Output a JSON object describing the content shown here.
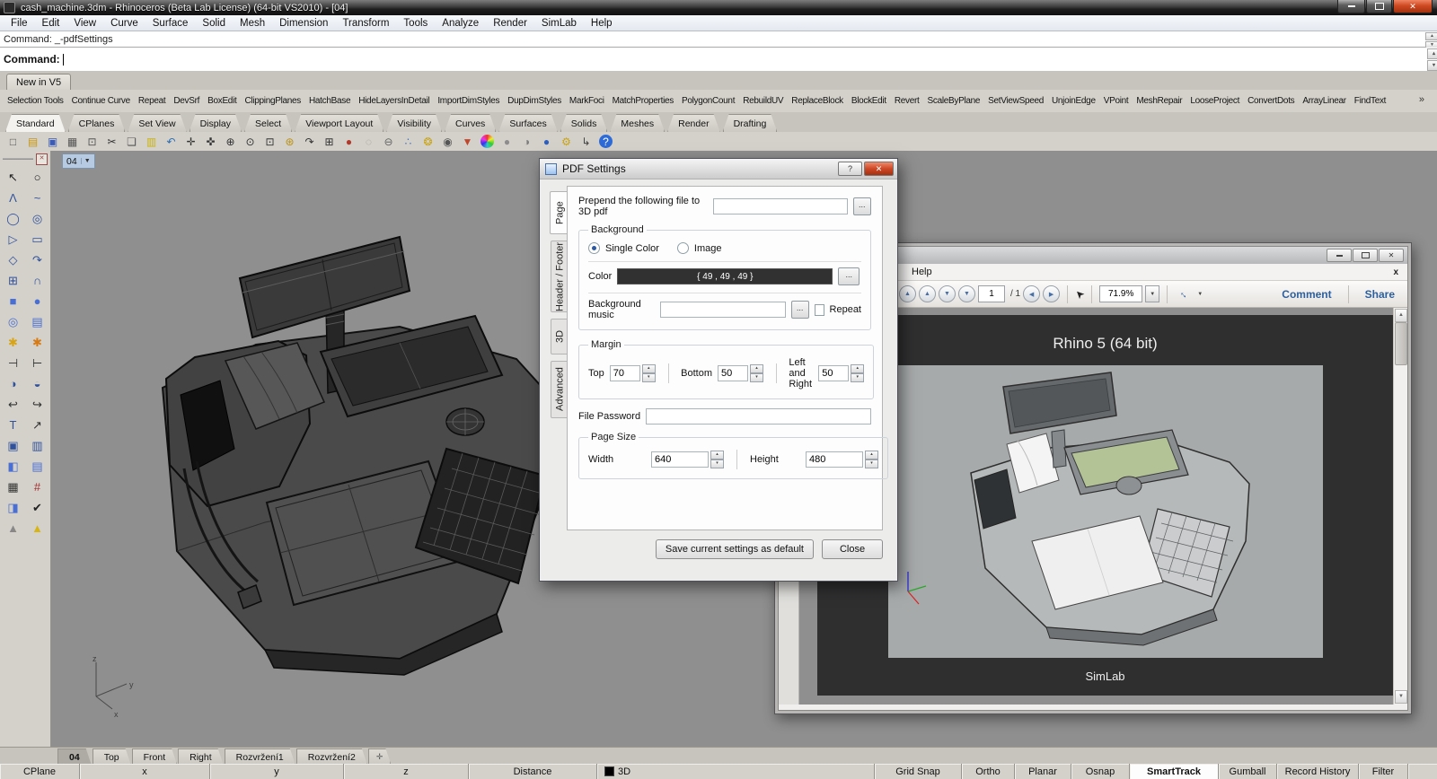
{
  "glyphs": {
    "close": "✕",
    "help": "?",
    "spin_up": "▴",
    "spin_down": "▾",
    "scroll_up": "▲",
    "scroll_down": "▼",
    "dd": "▼",
    "overflow": "»",
    "select_tool": "➤",
    "fullscreen": "↔",
    "plus_tab": "✛"
  },
  "app": {
    "title": "cash_machine.3dm - Rhinoceros (Beta Lab License) (64-bit VS2010) - [04]",
    "menus": [
      "File",
      "Edit",
      "View",
      "Curve",
      "Surface",
      "Solid",
      "Mesh",
      "Dimension",
      "Transform",
      "Tools",
      "Analyze",
      "Render",
      "SimLab",
      "Help"
    ]
  },
  "command": {
    "history": "Command: _-pdfSettings",
    "prompt": "Command:"
  },
  "dock": {
    "group_tab": "New in V5",
    "links": [
      "Selection Tools",
      "Continue Curve",
      "Repeat",
      "DevSrf",
      "BoxEdit",
      "ClippingPlanes",
      "HatchBase",
      "HideLayersInDetail",
      "ImportDimStyles",
      "DupDimStyles",
      "MarkFoci",
      "MatchProperties",
      "PolygonCount",
      "RebuildUV",
      "ReplaceBlock",
      "BlockEdit",
      "Revert",
      "ScaleByPlane",
      "SetViewSpeed",
      "UnjoinEdge",
      "VPoint",
      "MeshRepair",
      "LooseProject",
      "ConvertDots",
      "ArrayLinear",
      "FindText"
    ]
  },
  "toolbar_tabs": [
    {
      "label": "Standard",
      "active": true
    },
    {
      "label": "CPlanes"
    },
    {
      "label": "Set View"
    },
    {
      "label": "Display"
    },
    {
      "label": "Select"
    },
    {
      "label": "Viewport Layout"
    },
    {
      "label": "Visibility"
    },
    {
      "label": "Curves"
    },
    {
      "label": "Surfaces"
    },
    {
      "label": "Solids"
    },
    {
      "label": "Meshes"
    },
    {
      "label": "Render"
    },
    {
      "label": "Drafting"
    }
  ],
  "std_icons": [
    {
      "name": "new-file-icon",
      "g": "□",
      "c": "#555"
    },
    {
      "name": "open-icon",
      "g": "▤",
      "c": "#c99714"
    },
    {
      "name": "save-icon",
      "g": "▣",
      "c": "#3b5bb5"
    },
    {
      "name": "print-icon",
      "g": "▦",
      "c": "#555"
    },
    {
      "name": "export-icon",
      "g": "⊡",
      "c": "#555"
    },
    {
      "name": "cut-icon",
      "g": "✂",
      "c": "#333"
    },
    {
      "name": "copy-icon",
      "g": "❏",
      "c": "#555"
    },
    {
      "name": "paste-icon",
      "g": "▥",
      "c": "#c9b414"
    },
    {
      "name": "undo-icon",
      "g": "↶",
      "c": "#2f6fb3"
    },
    {
      "name": "pan-icon",
      "g": "✛",
      "c": "#333"
    },
    {
      "name": "orbit-icon",
      "g": "✜",
      "c": "#333"
    },
    {
      "name": "zoom-in-icon",
      "g": "⊕",
      "c": "#333"
    },
    {
      "name": "zoom-dynamic-icon",
      "g": "⊙",
      "c": "#333"
    },
    {
      "name": "zoom-window-icon",
      "g": "⊡",
      "c": "#333"
    },
    {
      "name": "zoom-extents-icon",
      "g": "⊛",
      "c": "#b99114"
    },
    {
      "name": "rotate-view-icon",
      "g": "↷",
      "c": "#333"
    },
    {
      "name": "viewport-layout-icon",
      "g": "⊞",
      "c": "#333"
    },
    {
      "name": "car-icon",
      "g": "●",
      "c": "#b33a2a"
    },
    {
      "name": "ghost-icon",
      "g": "◌",
      "c": "#999"
    },
    {
      "name": "section-icon",
      "g": "⊖",
      "c": "#666"
    },
    {
      "name": "nodes-icon",
      "g": "∴",
      "c": "#4a72c4"
    },
    {
      "name": "lamp-icon",
      "g": "❂",
      "c": "#c9a414"
    },
    {
      "name": "lock-icon",
      "g": "◉",
      "c": "#555"
    },
    {
      "name": "shaded-display-icon",
      "g": "▼",
      "c": "#c1472b"
    },
    {
      "name": "color-wheel-icon",
      "g": "",
      "c": "#333",
      "bg": "conic-gradient(#e33,#ee3,#3c3,#3cc,#33e,#e3e,#e33)",
      "round": "50%"
    },
    {
      "name": "sphere-icon",
      "g": "●",
      "c": "#8d8d8d"
    },
    {
      "name": "sphere-shaded-icon",
      "g": "◑",
      "c": "#7c7c7c"
    },
    {
      "name": "sphere-blue-icon",
      "g": "●",
      "c": "#2d5fc0"
    },
    {
      "name": "gear-icon",
      "g": "⚙",
      "c": "#c9a414"
    },
    {
      "name": "layout-lines-icon",
      "g": "↳",
      "c": "#444"
    },
    {
      "name": "help-icon",
      "g": "?",
      "c": "#fff",
      "bg": "#2e6bd6",
      "round": "50%"
    }
  ],
  "sidebar_icons": [
    {
      "name": "select-arrow-icon",
      "g": "↖",
      "c": "#222"
    },
    {
      "name": "point-icon",
      "g": "○",
      "c": "#222"
    },
    {
      "name": "polyline-icon",
      "g": "Λ",
      "c": "#30519c"
    },
    {
      "name": "curve-icon",
      "g": "~",
      "c": "#30519c"
    },
    {
      "name": "circle-icon",
      "g": "◯",
      "c": "#30519c"
    },
    {
      "name": "ellipse-icon",
      "g": "◎",
      "c": "#30519c"
    },
    {
      "name": "arc-icon",
      "g": "▷",
      "c": "#30519c"
    },
    {
      "name": "rectangle-icon",
      "g": "▭",
      "c": "#30519c"
    },
    {
      "name": "polygon-icon",
      "g": "◇",
      "c": "#30519c"
    },
    {
      "name": "freeform-curve-icon",
      "g": "↷",
      "c": "#30519c"
    },
    {
      "name": "surface-icon",
      "g": "⊞",
      "c": "#30519c"
    },
    {
      "name": "patch-icon",
      "g": "∩",
      "c": "#30519c"
    },
    {
      "name": "box-icon",
      "g": "■",
      "c": "#4a6fd4"
    },
    {
      "name": "sphere-solid-icon",
      "g": "●",
      "c": "#4a6fd4"
    },
    {
      "name": "torus-icon",
      "g": "◎",
      "c": "#4a6fd4"
    },
    {
      "name": "planes-icon",
      "g": "▤",
      "c": "#4a6fd4"
    },
    {
      "name": "explode-icon",
      "g": "✱",
      "c": "#d8a414"
    },
    {
      "name": "burst-icon",
      "g": "✱",
      "c": "#d87a14"
    },
    {
      "name": "trim-icon",
      "g": "⊣",
      "c": "#333"
    },
    {
      "name": "split-icon",
      "g": "⊢",
      "c": "#333"
    },
    {
      "name": "boolean-union-icon",
      "g": "◑",
      "c": "#30519c"
    },
    {
      "name": "boolean-diff-icon",
      "g": "◒",
      "c": "#30519c"
    },
    {
      "name": "fillet-icon",
      "g": "↩",
      "c": "#333"
    },
    {
      "name": "blend-icon",
      "g": "↪",
      "c": "#333"
    },
    {
      "name": "text-icon",
      "g": "T",
      "c": "#30519c"
    },
    {
      "name": "dimension-icon",
      "g": "↗",
      "c": "#333"
    },
    {
      "name": "block-icon",
      "g": "▣",
      "c": "#30519c"
    },
    {
      "name": "array-edit-icon",
      "g": "▥",
      "c": "#30519c"
    },
    {
      "name": "solid-tools-icon",
      "g": "◧",
      "c": "#4a6fd4"
    },
    {
      "name": "extrude-icon",
      "g": "▤",
      "c": "#4a6fd4"
    },
    {
      "name": "array-icon",
      "g": "▦",
      "c": "#333"
    },
    {
      "name": "frame-icon",
      "g": "#",
      "c": "#a03030"
    },
    {
      "name": "paint-icon",
      "g": "◨",
      "c": "#4a6fd4"
    },
    {
      "name": "check-icon",
      "g": "✔",
      "c": "#222"
    },
    {
      "name": "cone-icon",
      "g": "▲",
      "c": "#888"
    },
    {
      "name": "pyramid-icon",
      "g": "▲",
      "c": "#d8b414"
    }
  ],
  "viewport": {
    "tab": "04",
    "axis": {
      "x": "x",
      "y": "y",
      "z": "z"
    }
  },
  "viewport_tabs": [
    {
      "label": "04",
      "active": true
    },
    {
      "label": "Top"
    },
    {
      "label": "Front"
    },
    {
      "label": "Right"
    },
    {
      "label": "Rozvržení1"
    },
    {
      "label": "Rozvržení2"
    }
  ],
  "status": {
    "cells": [
      "CPlane",
      "x",
      "y",
      "z",
      "Distance"
    ],
    "layer": "3D",
    "toggles": [
      {
        "label": "Grid Snap"
      },
      {
        "label": "Ortho"
      },
      {
        "label": "Planar"
      },
      {
        "label": "Osnap"
      },
      {
        "label": "SmartTrack",
        "active": true
      },
      {
        "label": "Gumball"
      },
      {
        "label": "Record History"
      },
      {
        "label": "Filter"
      }
    ]
  },
  "dialog": {
    "title": "PDF Settings",
    "tabs": [
      {
        "label": "Page",
        "active": true
      },
      {
        "label": "Header / Footer"
      },
      {
        "label": "3D"
      },
      {
        "label": "Advanced"
      }
    ],
    "prepend_label": "Prepend the following file to 3D pdf",
    "browse": "...",
    "background_legend": "Background",
    "single_color": "Single Color",
    "image": "Image",
    "color_label": "Color",
    "color_value": "{ 49 , 49 , 49 }",
    "color_hex": "#313131",
    "music_label": "Background music",
    "repeat_label": "Repeat",
    "margin_legend": "Margin",
    "top_label": "Top",
    "top_value": "70",
    "bottom_label": "Bottom",
    "bottom_value": "50",
    "lr_label": "Left and Right",
    "lr_value": "50",
    "password_label": "File Password",
    "pagesize_legend": "Page Size",
    "width_label": "Width",
    "width_value": "640",
    "height_label": "Height",
    "height_value": "480",
    "save_btn": "Save current settings as default",
    "close_btn": "Close"
  },
  "pdf": {
    "menu_help": "Help",
    "close_doc": "x",
    "page": "1",
    "page_total": "/ 1",
    "zoom": "71.9%",
    "comment": "Comment",
    "share": "Share",
    "nav": [
      {
        "name": "first-page-button",
        "g": "▲"
      },
      {
        "name": "previous-page-button",
        "g": "▲"
      },
      {
        "name": "next-page-button",
        "g": "▼"
      },
      {
        "name": "last-page-button",
        "g": "▼"
      }
    ],
    "views": [
      {
        "name": "previous-view-button",
        "g": "◀"
      },
      {
        "name": "next-view-button",
        "g": "▶"
      }
    ],
    "doc_title": "Rhino 5 (64 bit)",
    "doc_footer": "SimLab"
  }
}
